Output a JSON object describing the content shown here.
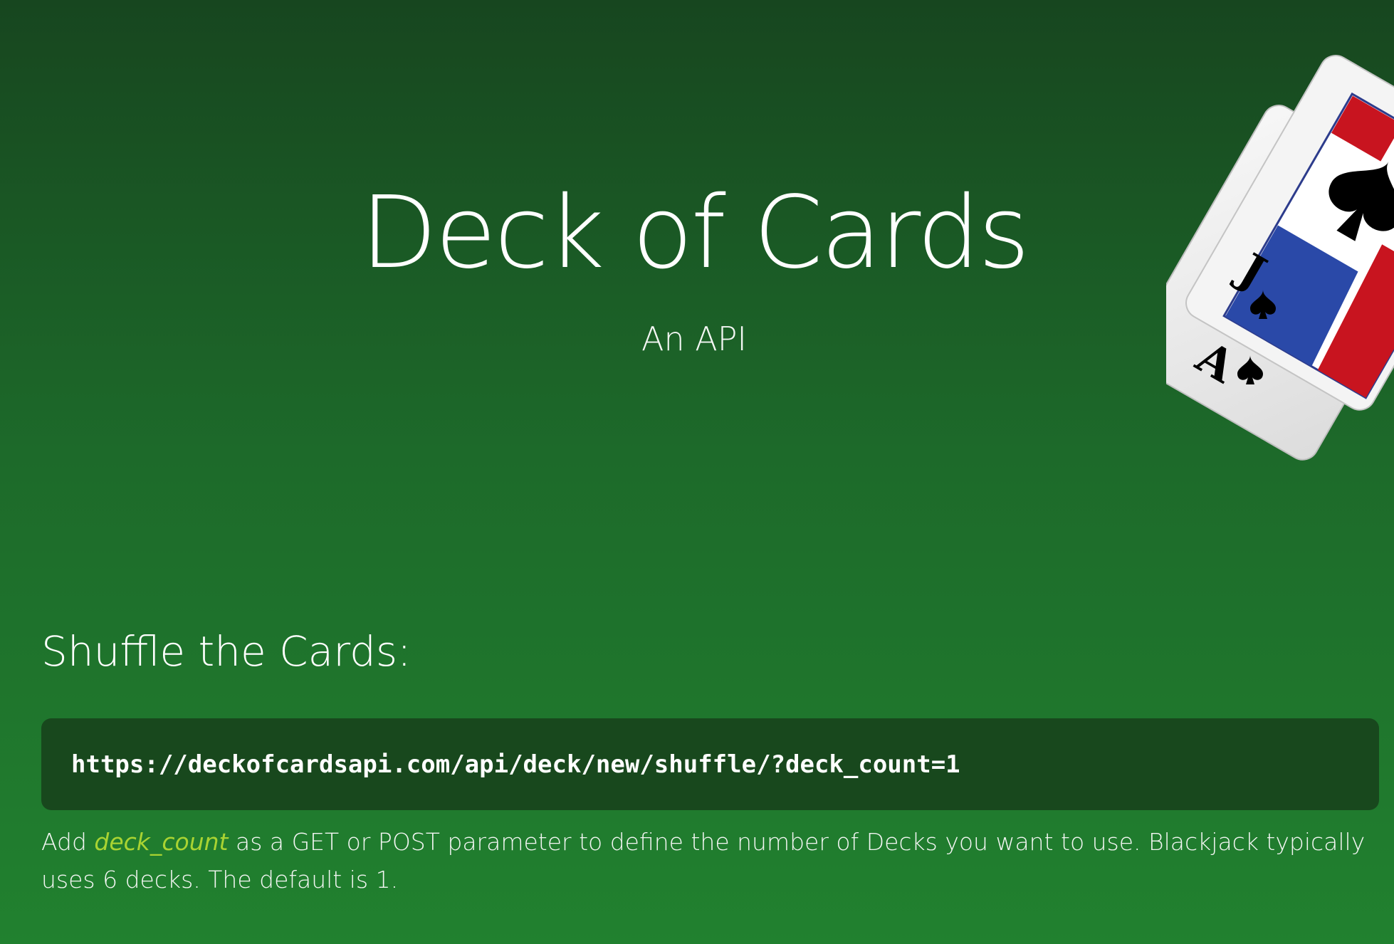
{
  "header": {
    "title": "Deck of Cards",
    "subtitle": "An API"
  },
  "hero_image": {
    "description_icon": "playing-cards-image",
    "cards": [
      {
        "rank": "J",
        "suit": "spade"
      },
      {
        "rank": "A",
        "suit": "spade"
      }
    ]
  },
  "section": {
    "heading": "Shuffle the Cards:",
    "code": "https://deckofcardsapi.com/api/deck/new/shuffle/?deck_count=1",
    "description_before": "Add ",
    "param_name": "deck_count",
    "description_after": " as a GET or POST parameter to define the number of Decks you want to use. Blackjack typically uses 6 decks. The default is 1."
  },
  "colors": {
    "background_top": "#17461f",
    "background_bottom": "#21812f",
    "code_background": "#18481d",
    "param_highlight": "#a9d332",
    "text": "#ffffff"
  }
}
